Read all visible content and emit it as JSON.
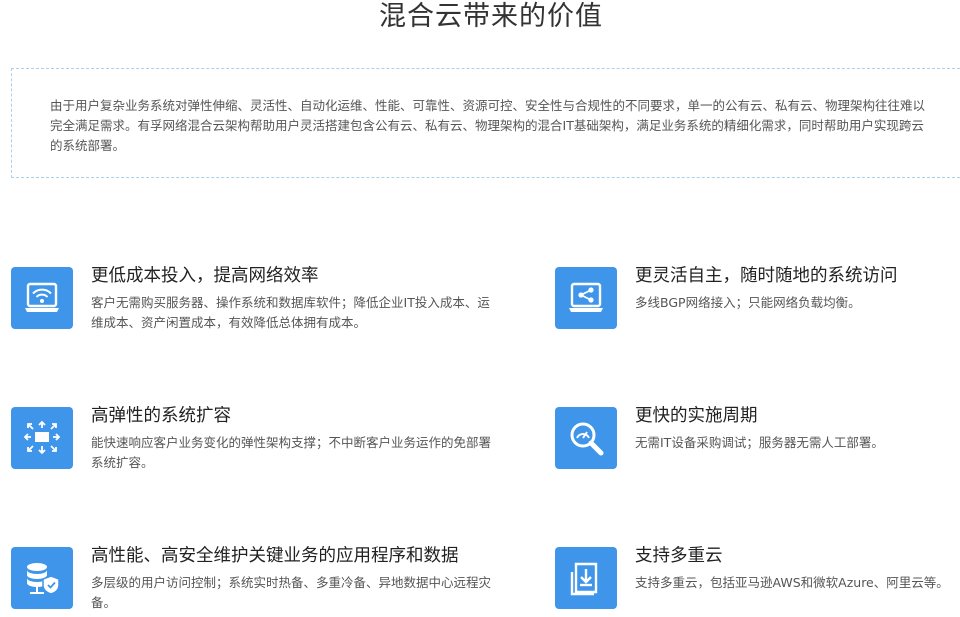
{
  "page": {
    "title": "混合云带来的价值",
    "intro": "由于用户复杂业务系统对弹性伸缩、灵活性、自动化运维、性能、可靠性、资源可控、安全性与合规性的不同要求，单一的公有云、私有云、物理架构往往难以完全满足需求。有孚网络混合云架构帮助用户灵活搭建包含公有云、私有云、物理架构的混合IT基础架构，满足业务系统的精细化需求，同时帮助用户实现跨云的系统部署。"
  },
  "features": [
    {
      "icon": "wifi-laptop-icon",
      "title": "更低成本投入，提高网络效率",
      "desc": "客户无需购买服务器、操作系统和数据库软件；降低企业IT投入成本、运维成本、资产闲置成本，有效降低总体拥有成本。"
    },
    {
      "icon": "share-laptop-icon",
      "title": "更灵活自主，随时随地的系统访问",
      "desc": "多线BGP网络接入；只能网络负载均衡。"
    },
    {
      "icon": "expand-arrows-icon",
      "title": "高弹性的系统扩容",
      "desc": "能快速响应客户业务变化的弹性架构支撑；不中断客户业务运作的免部署系统扩容。"
    },
    {
      "icon": "magnifier-gauge-icon",
      "title": "更快的实施周期",
      "desc": "无需IT设备采购调试；服务器无需人工部署。"
    },
    {
      "icon": "database-shield-icon",
      "title": "高性能、高安全维护关键业务的应用程序和数据",
      "desc": "多层级的用户访问控制；系统实时热备、多重冷备、异地数据中心远程灾备。"
    },
    {
      "icon": "download-tray-icon",
      "title": "支持多重云",
      "desc": "支持多重云，包括亚马逊AWS和微软Azure、阿里云等。"
    }
  ],
  "colors": {
    "icon_bg": "#3e95ea",
    "intro_border": "#a9d0ec"
  }
}
